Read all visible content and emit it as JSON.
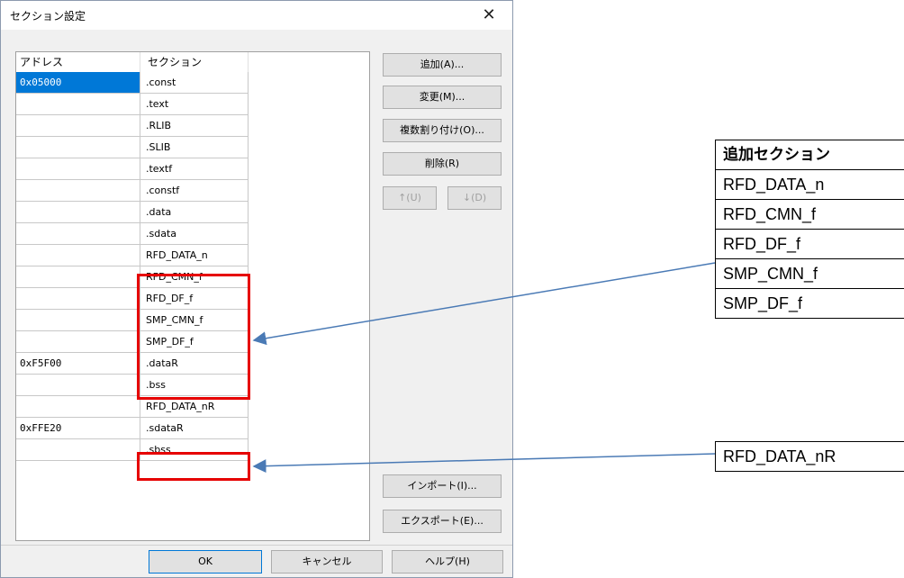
{
  "dialog": {
    "title": "セクション設定",
    "close": "✕",
    "columns": {
      "address": "アドレス",
      "section": "セクション"
    },
    "rows": [
      {
        "address": "0x05000",
        "section": ".const"
      },
      {
        "address": "",
        "section": ".text"
      },
      {
        "address": "",
        "section": ".RLIB"
      },
      {
        "address": "",
        "section": ".SLIB"
      },
      {
        "address": "",
        "section": ".textf"
      },
      {
        "address": "",
        "section": ".constf"
      },
      {
        "address": "",
        "section": ".data"
      },
      {
        "address": "",
        "section": ".sdata"
      },
      {
        "address": "",
        "section": "RFD_DATA_n"
      },
      {
        "address": "",
        "section": "RFD_CMN_f"
      },
      {
        "address": "",
        "section": "RFD_DF_f"
      },
      {
        "address": "",
        "section": "SMP_CMN_f"
      },
      {
        "address": "",
        "section": "SMP_DF_f"
      },
      {
        "address": "0xF5F00",
        "section": ".dataR"
      },
      {
        "address": "",
        "section": ".bss"
      },
      {
        "address": "",
        "section": "RFD_DATA_nR"
      },
      {
        "address": "0xFFE20",
        "section": ".sdataR"
      },
      {
        "address": "",
        "section": ".sbss"
      }
    ],
    "buttons": {
      "add": "追加(A)...",
      "modify": "変更(M)...",
      "multi_assign": "複数割り付け(O)...",
      "delete": "削除(R)",
      "up": "↑(U)",
      "down": "↓(D)",
      "import": "インポート(I)...",
      "export": "エクスポート(E)...",
      "ok": "OK",
      "cancel": "キャンセル",
      "help": "ヘルプ(H)"
    }
  },
  "annotation_table": {
    "header": "追加セクション",
    "items": [
      "RFD_DATA_n",
      "RFD_CMN_f",
      "RFD_DF_f",
      "SMP_CMN_f",
      "SMP_DF_f"
    ],
    "extra": "RFD_DATA_nR"
  },
  "colors": {
    "highlight_box": "#e60000",
    "arrow": "#4a7ab5",
    "selection": "#0078d7"
  }
}
